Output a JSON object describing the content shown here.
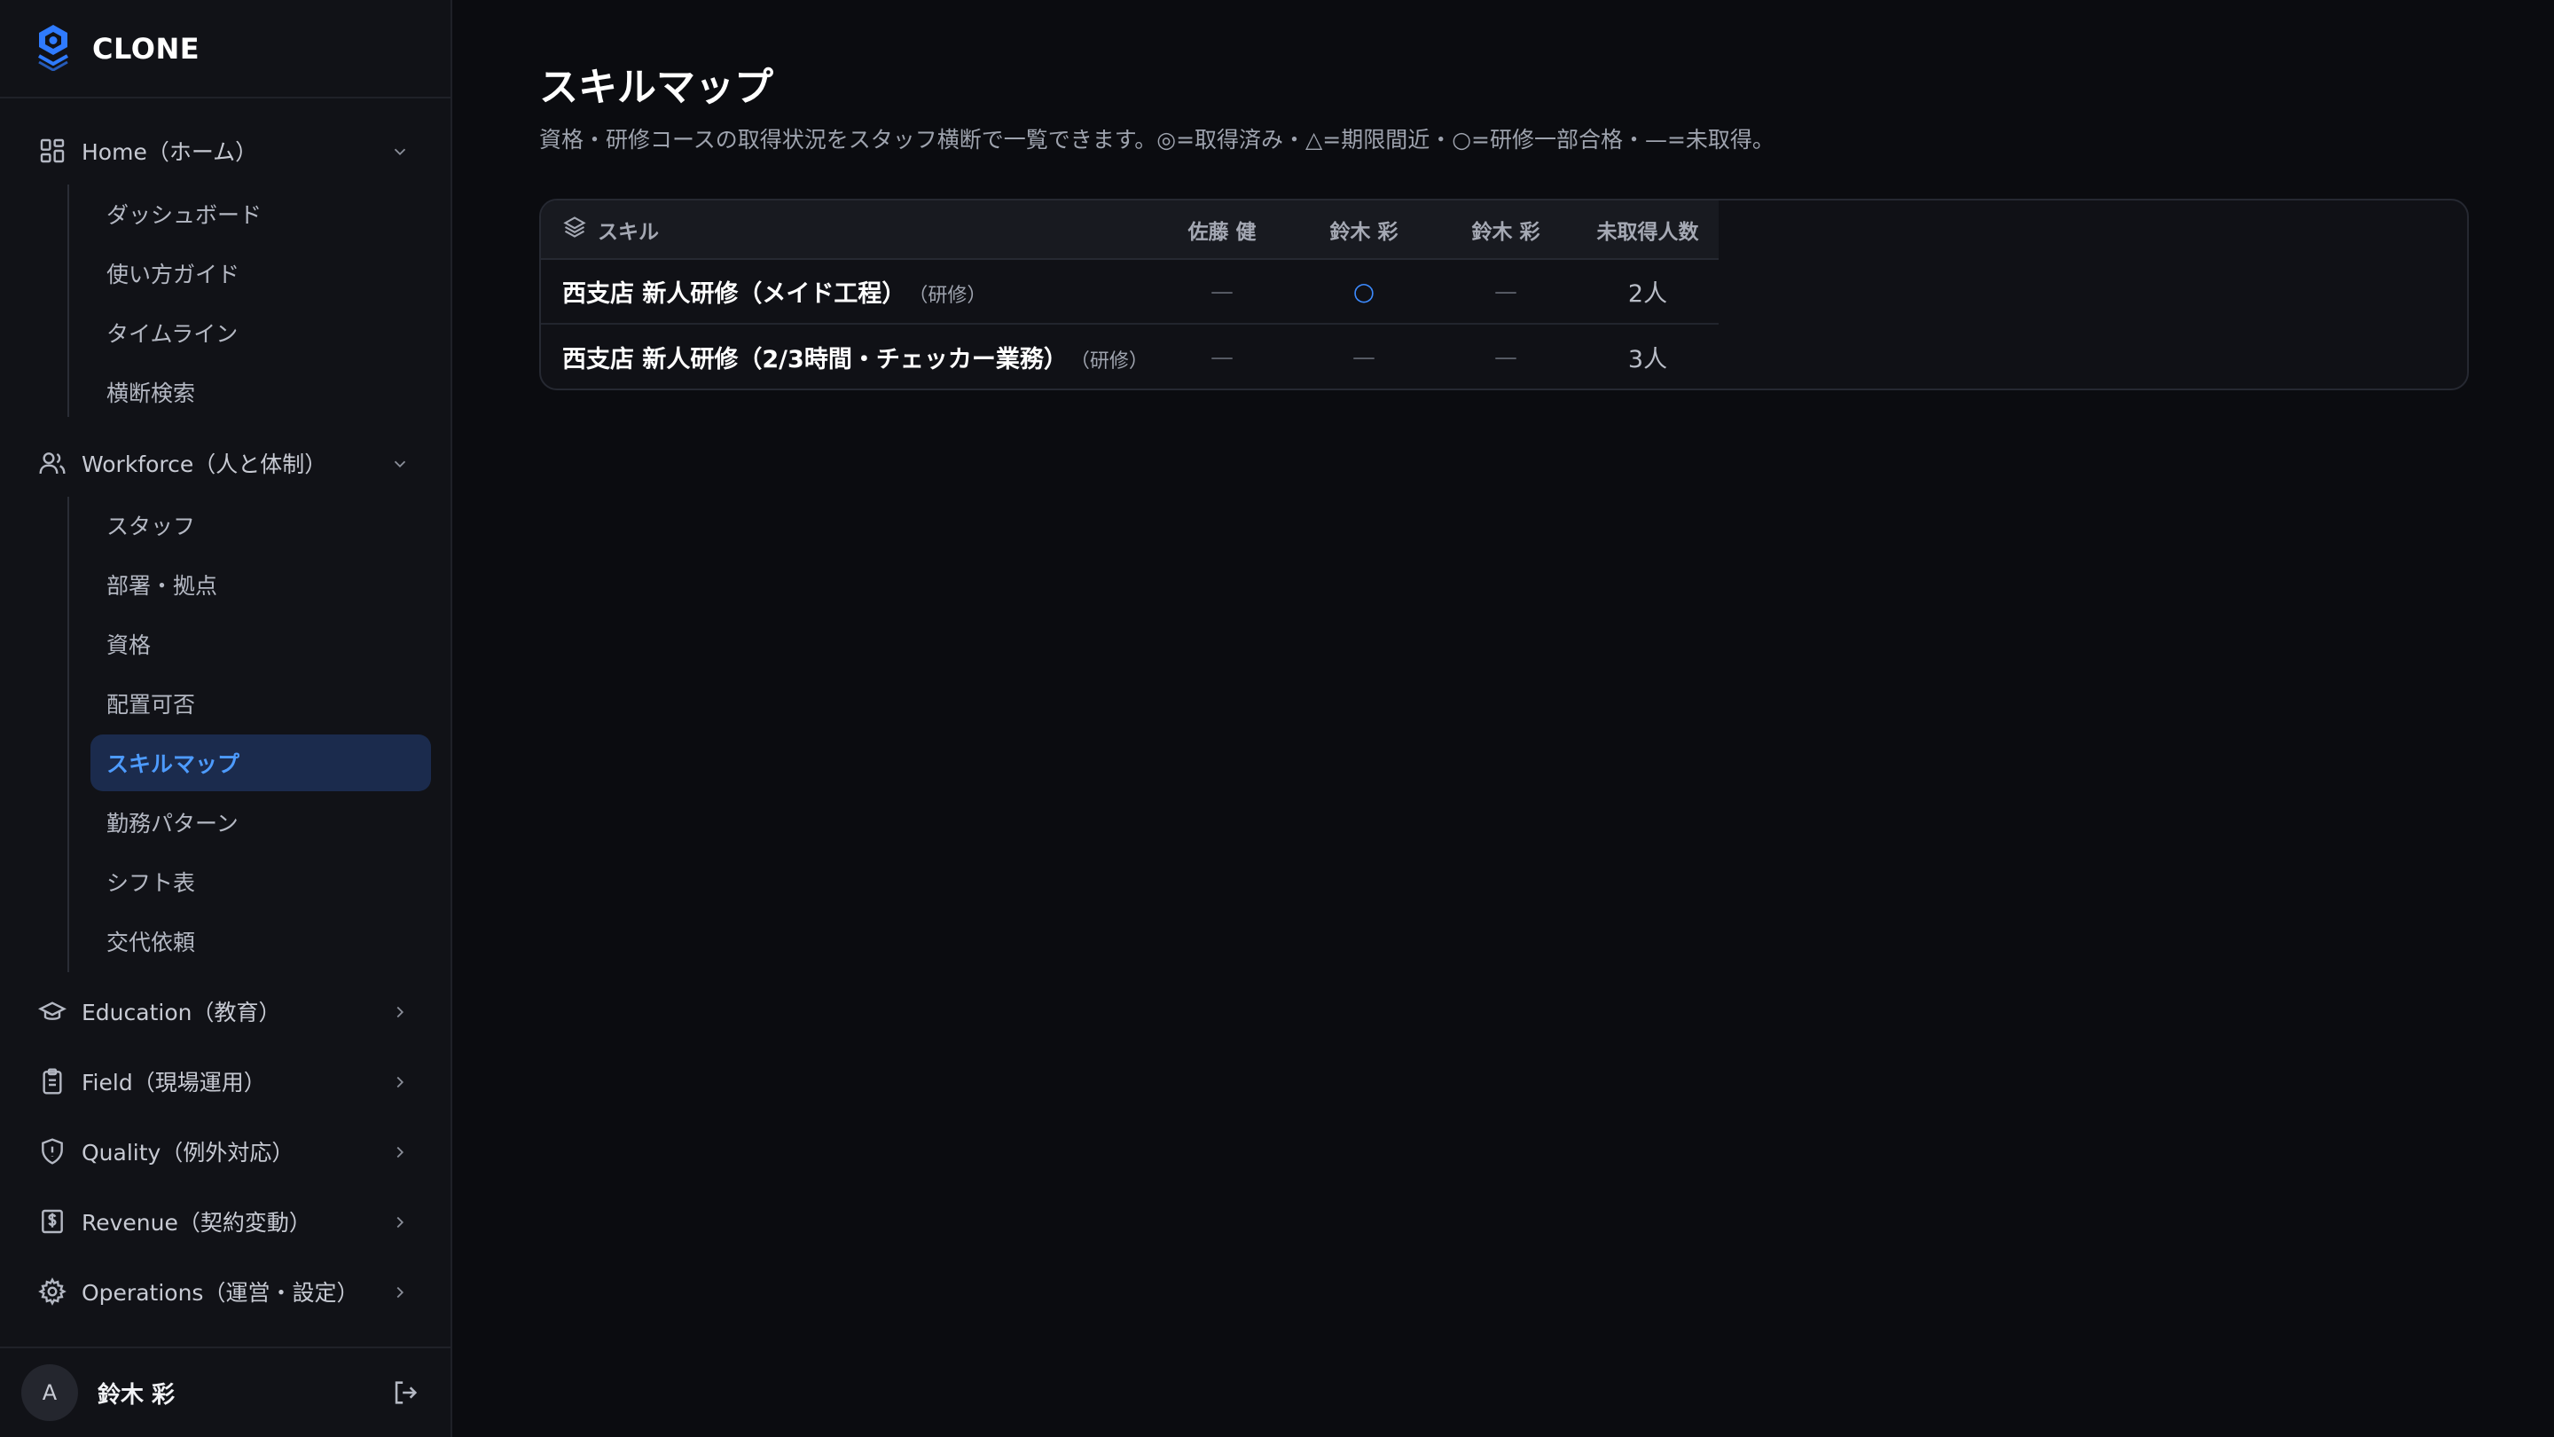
{
  "brand": {
    "name": "CLONE"
  },
  "sidebar": {
    "groups": [
      {
        "label": "Home（ホーム）",
        "icon": "grid-icon",
        "expanded": true,
        "items": [
          "ダッシュボード",
          "使い方ガイド",
          "タイムライン",
          "横断検索"
        ]
      },
      {
        "label": "Workforce（人と体制）",
        "icon": "users-icon",
        "expanded": true,
        "items": [
          "スタッフ",
          "部署・拠点",
          "資格",
          "配置可否",
          "スキルマップ",
          "勤務パターン",
          "シフト表",
          "交代依頼"
        ]
      },
      {
        "label": "Education（教育）",
        "icon": "graduation-cap-icon",
        "expanded": false
      },
      {
        "label": "Field（現場運用）",
        "icon": "clipboard-icon",
        "expanded": false
      },
      {
        "label": "Quality（例外対応）",
        "icon": "shield-icon",
        "expanded": false
      },
      {
        "label": "Revenue（契約変動）",
        "icon": "receipt-dollar-icon",
        "expanded": false
      },
      {
        "label": "Operations（運営・設定）",
        "icon": "gear-icon",
        "expanded": false
      }
    ],
    "active_item": "スキルマップ"
  },
  "user": {
    "avatar_initial": "A",
    "name": "鈴木 彩"
  },
  "page": {
    "title": "スキルマップ",
    "description": "資格・研修コースの取得状況をスタッフ横断で一覧できます。◎=取得済み・△=期限間近・○=研修一部合格・—=未取得。"
  },
  "table": {
    "header_skill": "スキル",
    "staff": [
      "佐藤 健",
      "鈴木 彩",
      "鈴木 彩"
    ],
    "header_count": "未取得人数",
    "rows": [
      {
        "name": "西支店 新人研修（メイド工程）",
        "tag": "（研修）",
        "marks": [
          "—",
          "○",
          "—"
        ],
        "count": "2人"
      },
      {
        "name": "西支店 新人研修（2/3時間・チェッカー業務）",
        "tag": "（研修）",
        "marks": [
          "—",
          "—",
          "—"
        ],
        "count": "3人"
      }
    ]
  },
  "colors": {
    "accent": "#3d8bff",
    "active_bg": "#1b2b4d",
    "background": "#0b0c10",
    "sidebar_bg": "#111217"
  }
}
